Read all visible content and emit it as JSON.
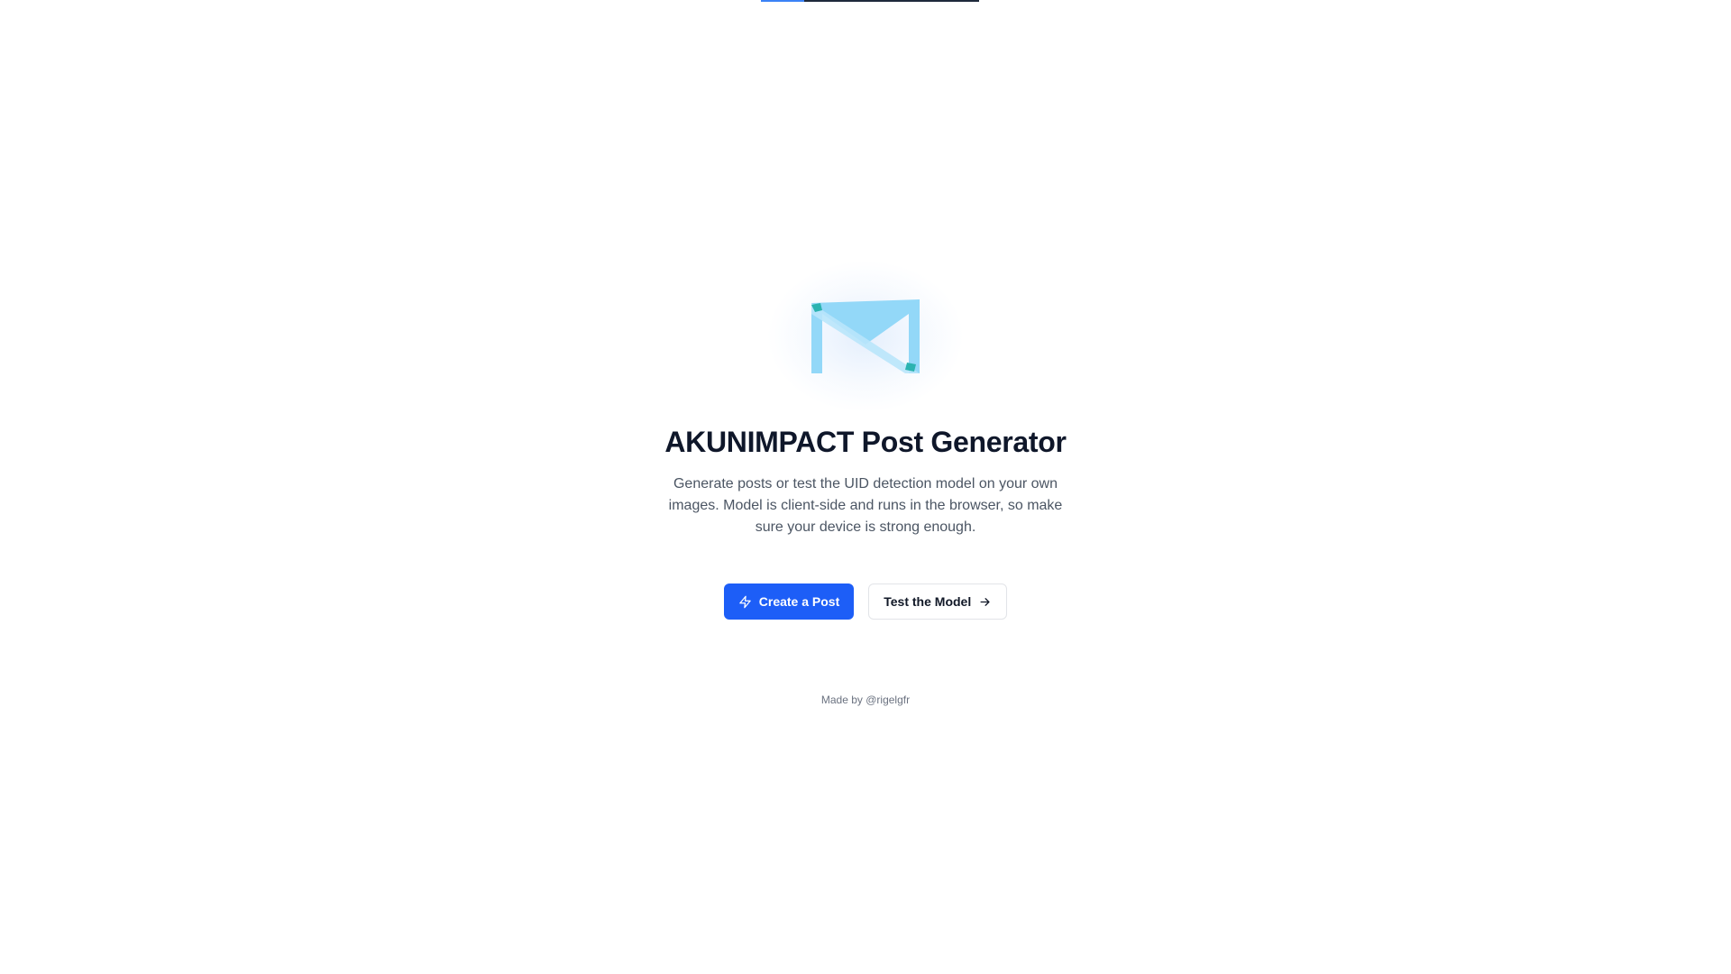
{
  "progress": {
    "fraction": 0.2
  },
  "logo": {
    "icon": "envelope-logo-icon",
    "color": "#93d8f8"
  },
  "hero": {
    "title": "AKUNIMPACT Post Generator",
    "description": "Generate posts or test the UID detection model on your own images. Model is client-side and runs in the browser, so make sure your device is strong enough."
  },
  "actions": {
    "create_label": "Create a Post",
    "create_icon": "lightning-icon",
    "test_label": "Test the Model",
    "test_icon": "arrow-right-icon"
  },
  "footer": {
    "credit": "Made by @rigelgfr"
  },
  "colors": {
    "primary": "#1d5ef7",
    "title": "#0f172a",
    "text_muted": "#4b5563"
  }
}
